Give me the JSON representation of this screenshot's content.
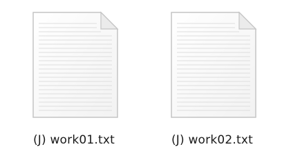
{
  "files": [
    {
      "name": "(J) work01.txt",
      "icon": "text-document-icon"
    },
    {
      "name": "(J) work02.txt",
      "icon": "text-document-icon"
    }
  ],
  "colors": {
    "page_border": "#c9c9c9",
    "page_fill": "#fbfbfb",
    "ruled_line": "#dcdcdc",
    "fold_fill": "#ececec",
    "label_text": "#1a1a1a"
  }
}
